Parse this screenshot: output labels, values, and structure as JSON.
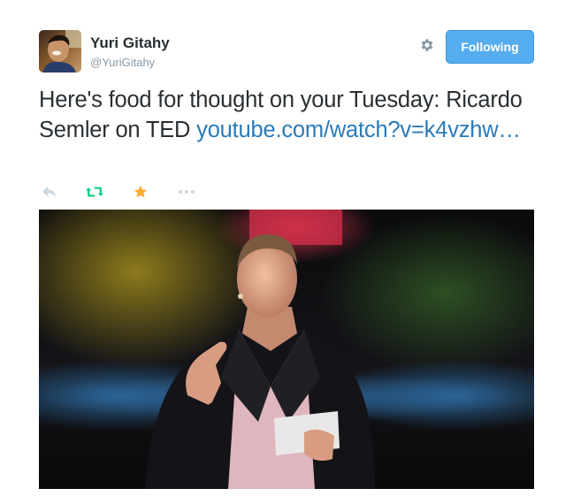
{
  "tweet": {
    "author_name": "Yuri Gitahy",
    "author_handle": "@YuriGitahy",
    "follow_label": "Following",
    "text_plain": "Here's food for thought on your Tuesday: Ricardo Semler on TED ",
    "link_text": "youtube.com/watch?v=k4vzhw…",
    "icons": {
      "settings": "gear-icon",
      "reply": "reply-icon",
      "retweet": "retweet-icon",
      "favorite": "star-icon",
      "more": "more-icon"
    },
    "colors": {
      "follow_button": "#55acee",
      "link": "#2b7bb9",
      "retweet_active": "#19cf86",
      "favorite_active": "#ffac33",
      "muted": "#8899a6"
    }
  }
}
